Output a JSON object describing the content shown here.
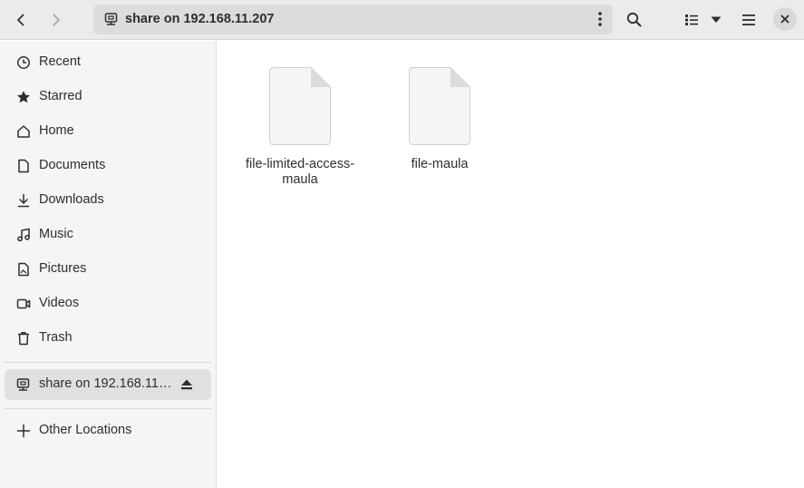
{
  "header": {
    "path_label": "share on 192.168.11.207"
  },
  "icons": {
    "back": "go-previous-icon",
    "forward": "go-next-icon",
    "network": "network-server-icon",
    "kebab": "view-more-icon",
    "search": "search-icon",
    "view": "view-list-icon",
    "view_dropdown": "pan-down-icon",
    "menu": "hamburger-menu-icon",
    "close": "close-icon"
  },
  "sidebar": {
    "items": [
      {
        "label": "Recent",
        "icon": "clock-icon"
      },
      {
        "label": "Starred",
        "icon": "star-icon"
      },
      {
        "label": "Home",
        "icon": "home-icon"
      },
      {
        "label": "Documents",
        "icon": "document-icon"
      },
      {
        "label": "Downloads",
        "icon": "download-icon"
      },
      {
        "label": "Music",
        "icon": "music-icon"
      },
      {
        "label": "Pictures",
        "icon": "image-icon"
      },
      {
        "label": "Videos",
        "icon": "video-icon"
      },
      {
        "label": "Trash",
        "icon": "trash-icon"
      }
    ],
    "mount": {
      "label": "share on 192.168.11…",
      "icon": "network-server-icon",
      "eject_icon": "eject-icon"
    },
    "other": {
      "label": "Other Locations",
      "icon": "plus-icon"
    }
  },
  "files": [
    {
      "name": "file-limited-access-maula",
      "name_line1": "file-limited-access-",
      "name_line2": "maula"
    },
    {
      "name": "file-maula",
      "name_line1": "file-maula",
      "name_line2": ""
    }
  ],
  "colors": {
    "header_bg": "#ebebeb",
    "sidebar_bg": "#f6f5f4",
    "selected_bg": "#e0e0e0",
    "icon_fg": "#2e2e2e"
  }
}
